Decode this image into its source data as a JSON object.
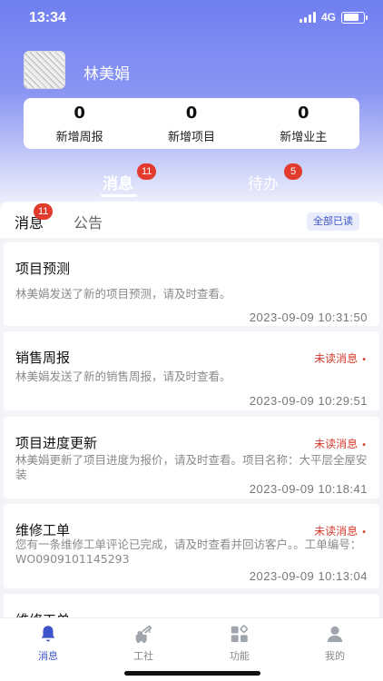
{
  "status_bar": {
    "time": "13:34",
    "network": "4G"
  },
  "profile": {
    "name": "林美娟"
  },
  "stats": [
    {
      "value": "0",
      "label": "新增周报"
    },
    {
      "value": "0",
      "label": "新增项目"
    },
    {
      "value": "0",
      "label": "新增业主"
    }
  ],
  "main_tabs": [
    {
      "label": "消息",
      "badge": "11",
      "active": true
    },
    {
      "label": "待办",
      "badge": "5",
      "active": false
    }
  ],
  "sub_tabs": [
    {
      "label": "消息",
      "badge": "11",
      "active": true
    },
    {
      "label": "公告",
      "active": false
    }
  ],
  "mark_all_read": "全部已读",
  "messages": [
    {
      "title": "项目预测",
      "unread_label": "",
      "body": "林美娟发送了新的项目预测，请及时查看。",
      "time": "2023-09-09 10:31:50"
    },
    {
      "title": "销售周报",
      "unread_label": "未读消息",
      "body": "林美娟发送了新的销售周报，请及时查看。",
      "time": "2023-09-09 10:29:51"
    },
    {
      "title": "项目进度更新",
      "unread_label": "未读消息",
      "body": "林美娟更新了项目进度为报价，请及时查看。项目名称：大平层全屋安装",
      "time": "2023-09-09 10:18:41"
    },
    {
      "title": "维修工单",
      "unread_label": "未读消息",
      "body": "您有一条维修工单评论已完成，请及时查看并回访客户。。工单编号：WO0909101145293",
      "time": "2023-09-09 10:13:04"
    },
    {
      "title": "维修工单",
      "unread_label": "",
      "body": "",
      "time": ""
    }
  ],
  "bottom_nav": [
    {
      "label": "消息",
      "icon": "bell-icon",
      "active": true
    },
    {
      "label": "工社",
      "icon": "crane-icon",
      "active": false
    },
    {
      "label": "功能",
      "icon": "grid-icon",
      "active": false
    },
    {
      "label": "我的",
      "icon": "user-icon",
      "active": false
    }
  ],
  "colors": {
    "accent": "#3e55c9",
    "badge": "#e23b2e",
    "unread": "#d33a2c"
  }
}
